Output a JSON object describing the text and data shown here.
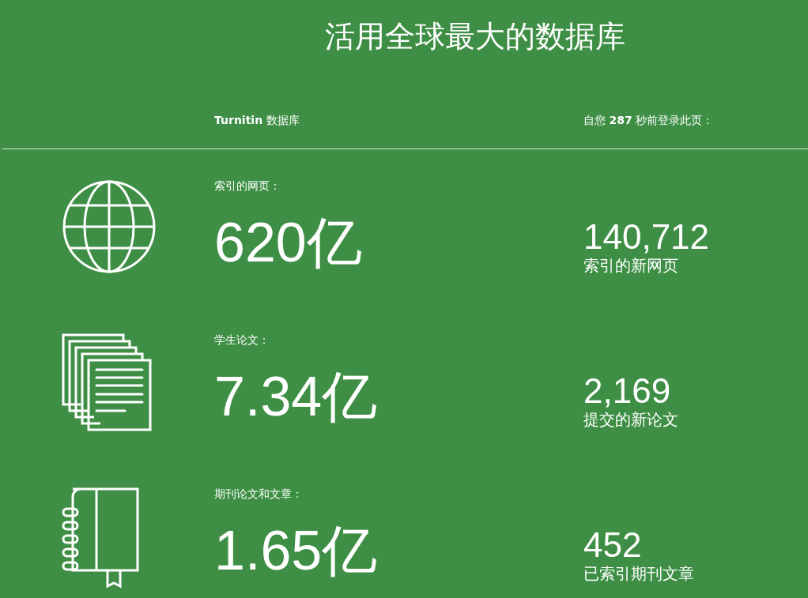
{
  "title": "活用全球最大的数据库",
  "header": {
    "left": "**Turnitin** 数据库",
    "right": "自您 **287** 秒前登录此页："
  },
  "stats": [
    {
      "kind": "globe",
      "label": "索引的网页：",
      "value": "620亿",
      "new_value": "140,712",
      "new_label": "索引的新网页"
    },
    {
      "kind": "papers",
      "label": "学生论文：",
      "value": "7.34亿",
      "new_value": "2,169",
      "new_label": "提交的新论文"
    },
    {
      "kind": "notebook",
      "label": "期刊论文和文章：",
      "value": "1.65亿",
      "new_value": "452",
      "new_label": "已索引期刊文章"
    }
  ]
}
